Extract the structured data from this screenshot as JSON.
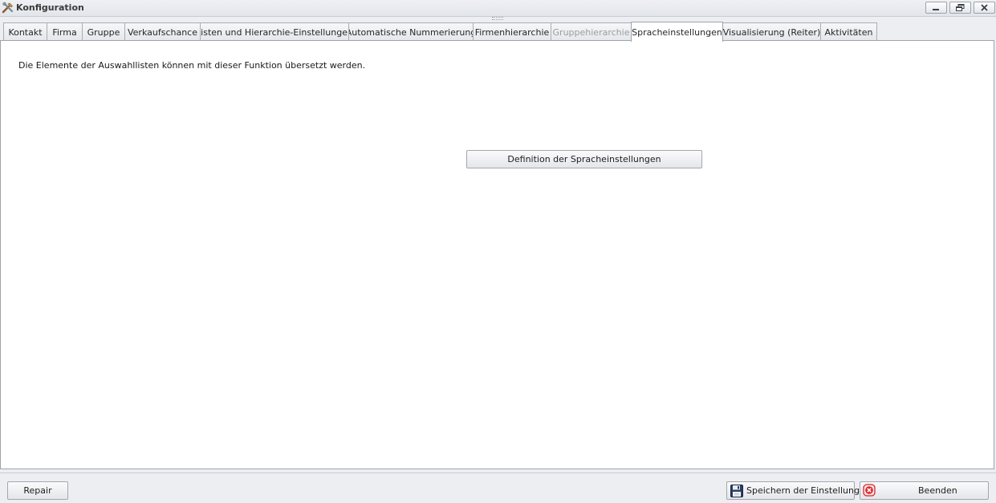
{
  "window": {
    "title": "Konfiguration",
    "app_icon": "tools-icon",
    "controls": {
      "minimize": "minimize-icon",
      "restore": "restore-icon",
      "close": "close-icon"
    }
  },
  "tabs": [
    {
      "label": "Kontakt",
      "state": "normal"
    },
    {
      "label": "Firma",
      "state": "normal"
    },
    {
      "label": "Gruppe",
      "state": "normal"
    },
    {
      "label": "Verkaufschance",
      "state": "normal"
    },
    {
      "label": "Listen und Hierarchie-Einstellungen",
      "state": "normal"
    },
    {
      "label": "Automatische Nummerierung",
      "state": "normal"
    },
    {
      "label": "Firmenhierarchie",
      "state": "normal"
    },
    {
      "label": "Gruppehierarchie",
      "state": "disabled"
    },
    {
      "label": "Spracheinstellungen",
      "state": "active"
    },
    {
      "label": "Visualisierung (Reiter)",
      "state": "normal"
    },
    {
      "label": "Aktivitäten",
      "state": "normal"
    }
  ],
  "panel": {
    "description": "Die Elemente der Auswahllisten können mit dieser Funktion übersetzt werden.",
    "define_button": "Definition der Spracheinstellungen"
  },
  "footer": {
    "repair_button": "Repair",
    "save_button": "Speichern der Einstellungen",
    "save_icon": "floppy-disk-icon",
    "exit_button": "Beenden",
    "exit_icon": "close-circle-icon"
  },
  "colors": {
    "window_bg": "#eceef2",
    "panel_bg": "#ffffff",
    "border": "#9fa4ab",
    "disabled_text": "#9c9c9c",
    "exit_icon_red": "#d8262b"
  }
}
